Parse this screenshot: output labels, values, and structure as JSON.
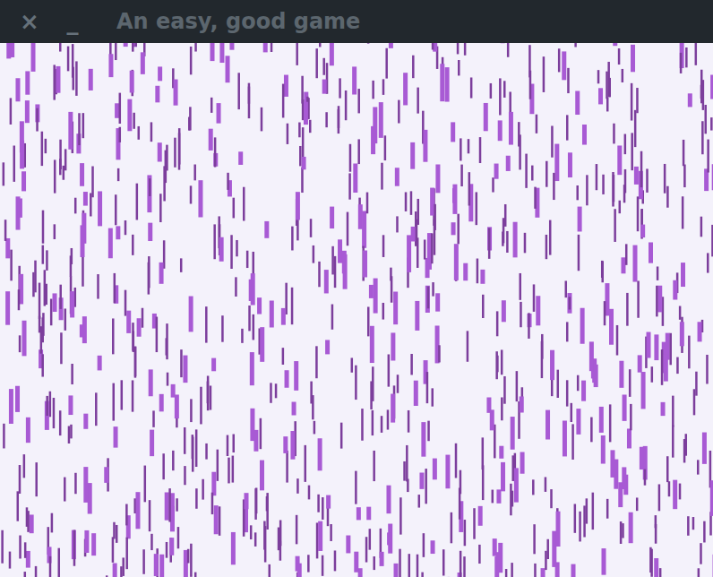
{
  "window": {
    "title": "An easy, good game"
  },
  "buttons": [
    {
      "name": "close",
      "label": "×"
    },
    {
      "name": "minimize",
      "label": "_"
    }
  ]
}
